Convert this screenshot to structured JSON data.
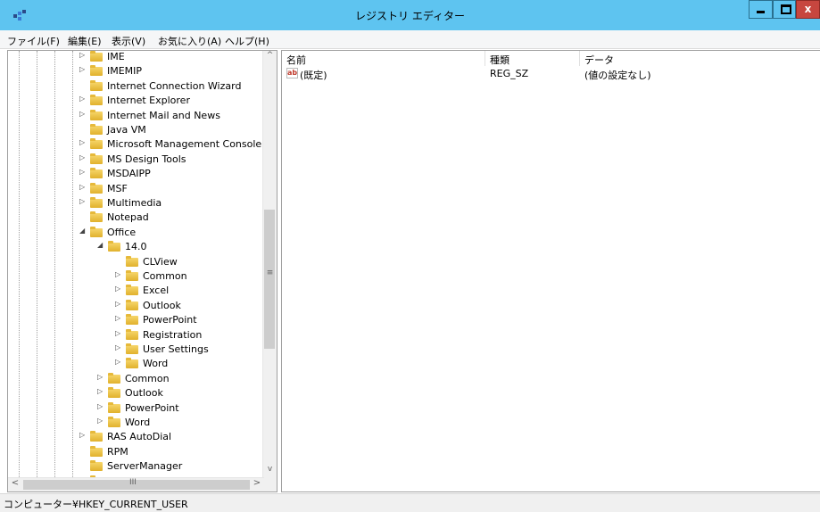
{
  "window": {
    "title": "レジストリ エディター",
    "controls": {
      "close_label": "x"
    }
  },
  "menu": [
    "ファイル(F)",
    "編集(E)",
    "表示(V)",
    "お気に入り(A)",
    "ヘルプ(H)"
  ],
  "tree": {
    "items": [
      {
        "label": "IME",
        "level": 0,
        "expander": "▷"
      },
      {
        "label": "IMEMIP",
        "level": 0,
        "expander": "▷"
      },
      {
        "label": "Internet Connection Wizard",
        "level": 0,
        "expander": ""
      },
      {
        "label": "Internet Explorer",
        "level": 0,
        "expander": "▷"
      },
      {
        "label": "Internet Mail and News",
        "level": 0,
        "expander": "▷"
      },
      {
        "label": "Java VM",
        "level": 0,
        "expander": ""
      },
      {
        "label": "Microsoft Management Console",
        "level": 0,
        "expander": "▷"
      },
      {
        "label": "MS Design Tools",
        "level": 0,
        "expander": "▷"
      },
      {
        "label": "MSDAIPP",
        "level": 0,
        "expander": "▷"
      },
      {
        "label": "MSF",
        "level": 0,
        "expander": "▷"
      },
      {
        "label": "Multimedia",
        "level": 0,
        "expander": "▷"
      },
      {
        "label": "Notepad",
        "level": 0,
        "expander": ""
      },
      {
        "label": "Office",
        "level": 0,
        "expander": "◢"
      },
      {
        "label": "14.0",
        "level": 1,
        "expander": "◢"
      },
      {
        "label": "CLView",
        "level": 2,
        "expander": ""
      },
      {
        "label": "Common",
        "level": 2,
        "expander": "▷"
      },
      {
        "label": "Excel",
        "level": 2,
        "expander": "▷"
      },
      {
        "label": "Outlook",
        "level": 2,
        "expander": "▷"
      },
      {
        "label": "PowerPoint",
        "level": 2,
        "expander": "▷"
      },
      {
        "label": "Registration",
        "level": 2,
        "expander": "▷"
      },
      {
        "label": "User Settings",
        "level": 2,
        "expander": "▷"
      },
      {
        "label": "Word",
        "level": 2,
        "expander": "▷"
      },
      {
        "label": "Common",
        "level": 1,
        "expander": "▷"
      },
      {
        "label": "Outlook",
        "level": 1,
        "expander": "▷"
      },
      {
        "label": "PowerPoint",
        "level": 1,
        "expander": "▷"
      },
      {
        "label": "Word",
        "level": 1,
        "expander": "▷"
      },
      {
        "label": "RAS AutoDial",
        "level": 0,
        "expander": "▷"
      },
      {
        "label": "RPM",
        "level": 0,
        "expander": ""
      },
      {
        "label": "ServerManager",
        "level": 0,
        "expander": ""
      },
      {
        "label": "Shared",
        "level": 0,
        "expander": ""
      }
    ],
    "hscroll_grip": "III",
    "vscroll_grip": "≡"
  },
  "list": {
    "columns": [
      "名前",
      "種類",
      "データ"
    ],
    "rows": [
      {
        "icon": "string-value-icon",
        "icon_text": "ab",
        "name": "(既定)",
        "type": "REG_SZ",
        "data": "(値の設定なし)"
      }
    ]
  },
  "status": {
    "path": "コンピューター¥HKEY_CURRENT_USER"
  },
  "colors": {
    "titlebar": "#5ec4f0",
    "close_button": "#c7463f",
    "folder": "#e1b12c"
  }
}
